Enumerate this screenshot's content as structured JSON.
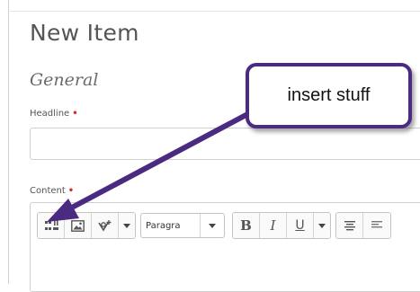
{
  "page": {
    "title": "New Item",
    "section": "General"
  },
  "fields": {
    "headline": {
      "label": "Headline",
      "required_mark": "•",
      "value": ""
    },
    "content": {
      "label": "Content",
      "required_mark": "•"
    }
  },
  "toolbar": {
    "insert_group": [
      {
        "name": "insert-block-icon"
      },
      {
        "name": "image-icon"
      },
      {
        "name": "insert-stuff-icon"
      },
      {
        "name": "insert-dropdown-caret"
      }
    ],
    "paragraph_select": {
      "value": "Paragra"
    },
    "format": {
      "bold": "B",
      "italic": "I",
      "underline": "U"
    },
    "align_group": [
      {
        "name": "align-icon"
      },
      {
        "name": "align-icon-2"
      }
    ]
  },
  "annotation": {
    "text": "insert stuff",
    "color": "#4b2b82"
  },
  "colors": {
    "required": "#e0242c",
    "callout_border": "#4b2b82",
    "arrow": "#4b2b82"
  }
}
